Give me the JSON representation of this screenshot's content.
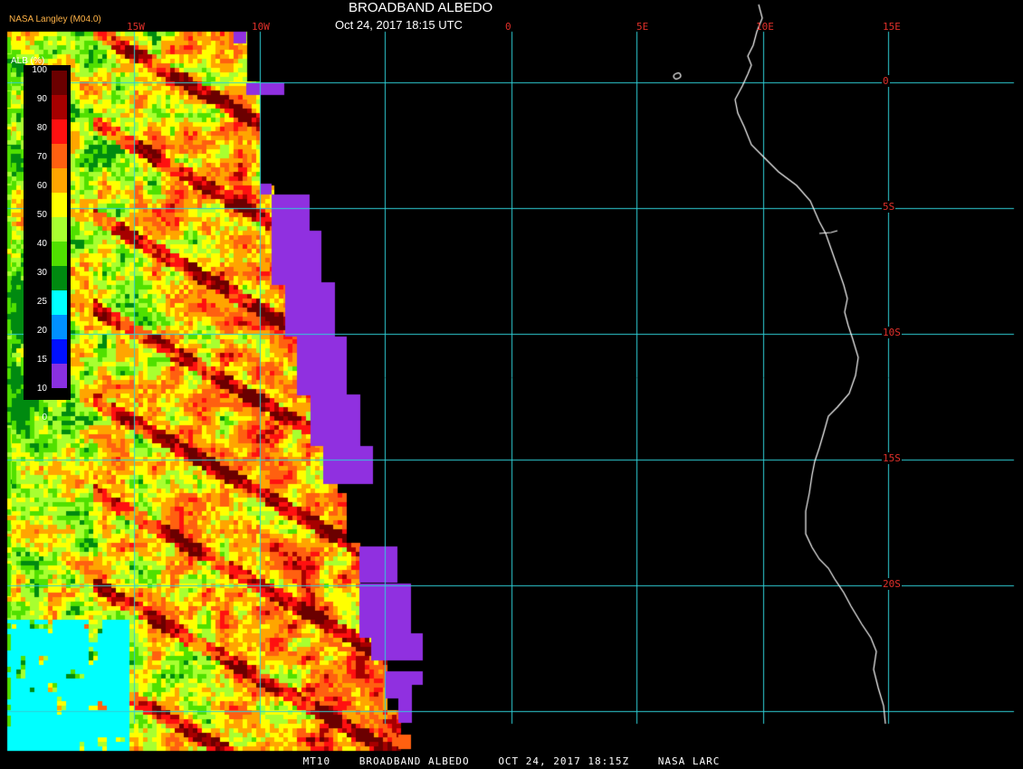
{
  "header": {
    "title": "BROADBAND ALBEDO",
    "subtitle": "Oct 24, 2017 18:15 UTC",
    "credit": "NASA Langley (M04.0)"
  },
  "footer": {
    "product": "MT10",
    "name": "BROADBAND ALBEDO",
    "datetime": "OCT 24, 2017 18:15Z",
    "agency": "NASA LARC"
  },
  "grid": {
    "lon_labels": [
      "15W",
      "10W",
      "0",
      "5E",
      "10E",
      "15E"
    ],
    "lat_labels": [
      "0",
      "5S",
      "10S",
      "15S",
      "20S"
    ]
  },
  "legend": {
    "title": "ALB (%)",
    "ticks": [
      "100",
      "90",
      "80",
      "70",
      "60",
      "50",
      "40",
      "30",
      "25",
      "20",
      "15",
      "10",
      "0"
    ],
    "colors": [
      "#6b0000",
      "#a60000",
      "#ff1010",
      "#ff6010",
      "#ffa500",
      "#ffff00",
      "#a8ff30",
      "#50e000",
      "#008a10",
      "#00ffff",
      "#0090ff",
      "#0010ff",
      "#8a30e0"
    ]
  },
  "colors": {
    "grid": "#2fd0d8",
    "coast": "#ffffff",
    "no_data": "#9030e0",
    "label": "#e0302a"
  }
}
